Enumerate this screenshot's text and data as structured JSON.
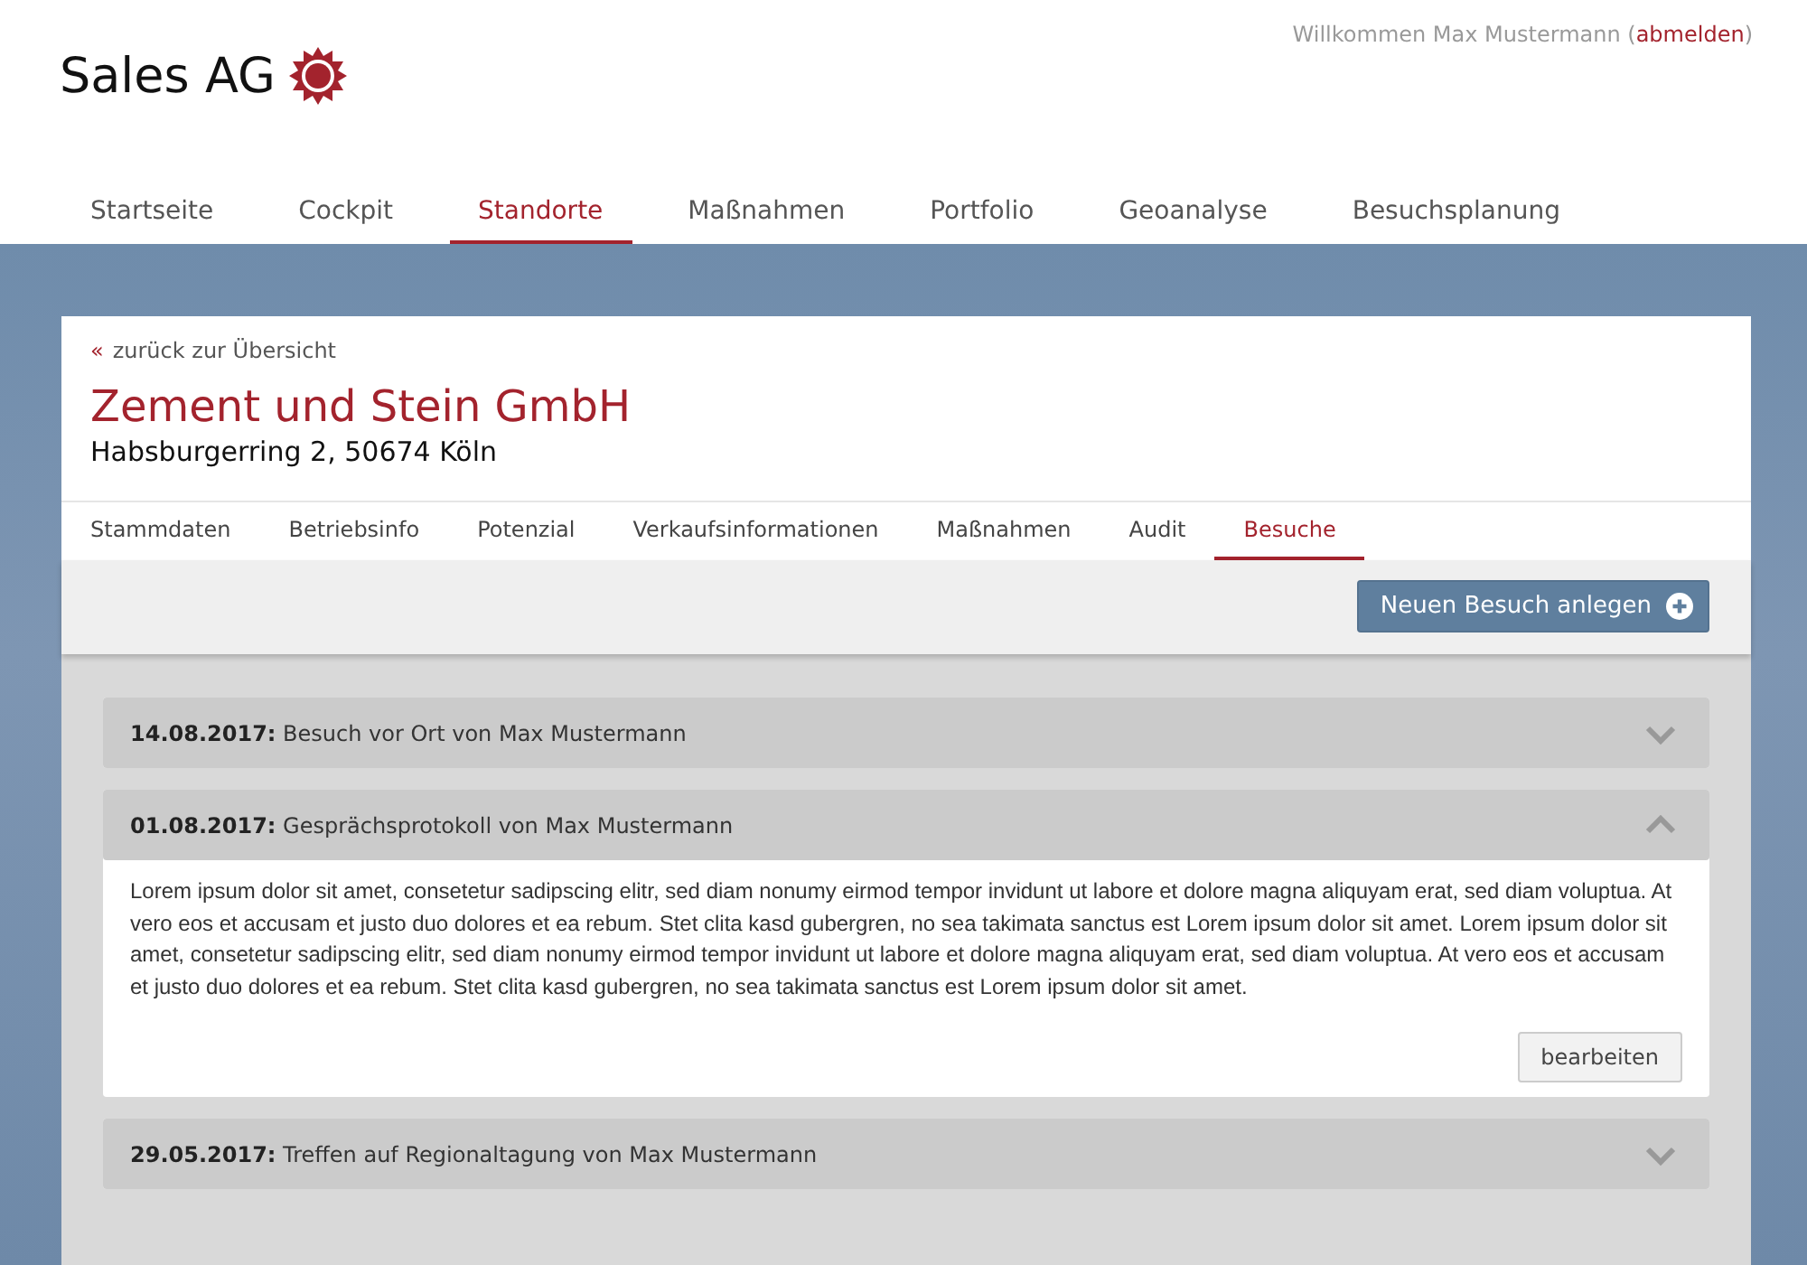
{
  "header": {
    "logo_text": "Sales AG",
    "welcome_prefix": "Willkommen Max Mustermann (",
    "logout_link": "abmelden",
    "welcome_suffix": ")"
  },
  "main_nav": [
    {
      "label": "Startseite",
      "selected": false
    },
    {
      "label": "Cockpit",
      "selected": false
    },
    {
      "label": "Standorte",
      "selected": true
    },
    {
      "label": "Maßnahmen",
      "selected": false
    },
    {
      "label": "Portfolio",
      "selected": false
    },
    {
      "label": "Geoanalyse",
      "selected": false
    },
    {
      "label": "Besuchsplanung",
      "selected": false
    }
  ],
  "detail": {
    "back_icon": "«",
    "back_link": "zurück zur Übersicht",
    "title": "Zement und Stein GmbH",
    "address": "Habsburgerring 2, 50674 Köln"
  },
  "tabs": [
    {
      "label": "Stammdaten",
      "selected": false
    },
    {
      "label": "Betriebsinfo",
      "selected": false
    },
    {
      "label": "Potenzial",
      "selected": false
    },
    {
      "label": "Verkaufsinformationen",
      "selected": false
    },
    {
      "label": "Maßnahmen",
      "selected": false
    },
    {
      "label": "Audit",
      "selected": false
    },
    {
      "label": "Besuche",
      "selected": true
    }
  ],
  "toolbar": {
    "new_button": "Neuen Besuch anlegen"
  },
  "visits": [
    {
      "heading": "**14.08.2017:** Besuch vor Ort von Max Mustermann",
      "expanded": false
    },
    {
      "heading": "**01.08.2017:** Gesprächsprotokoll von Max Mustermann",
      "expanded": true,
      "body": "Lorem ipsum dolor sit amet, consetetur sadipscing elitr, sed diam nonumy eirmod tempor invidunt ut labore et dolore magna aliquyam erat, sed diam voluptua. At vero eos et accusam et justo duo dolores et ea rebum. Stet clita kasd gubergren, no sea takimata sanctus est Lorem ipsum dolor sit amet. Lorem ipsum dolor sit amet, consetetur sadipscing elitr, sed diam nonumy eirmod tempor invidunt ut labore et dolore magna aliquyam erat, sed diam voluptua. At vero eos et accusam et justo duo dolores et ea rebum. Stet clita kasd gubergren, no sea takimata sanctus est Lorem ipsum dolor sit amet.",
      "edit_button": "bearbeiten"
    },
    {
      "heading": "**29.05.2017:** Treffen auf Regionaltagung von Max Mustermann",
      "expanded": false
    }
  ]
}
